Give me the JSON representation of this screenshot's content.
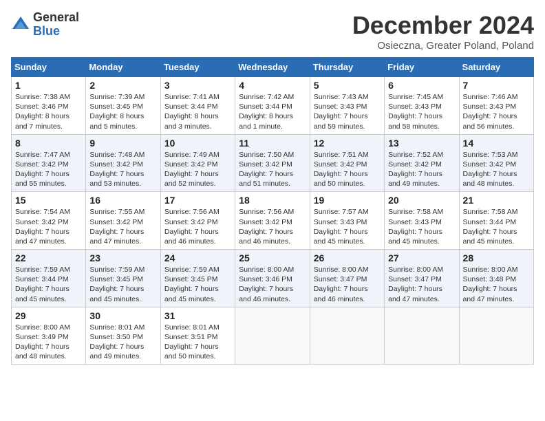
{
  "logo": {
    "general": "General",
    "blue": "Blue"
  },
  "title": "December 2024",
  "subtitle": "Osieczna, Greater Poland, Poland",
  "days_header": [
    "Sunday",
    "Monday",
    "Tuesday",
    "Wednesday",
    "Thursday",
    "Friday",
    "Saturday"
  ],
  "weeks": [
    [
      {
        "day": "1",
        "info": "Sunrise: 7:38 AM\nSunset: 3:46 PM\nDaylight: 8 hours\nand 7 minutes."
      },
      {
        "day": "2",
        "info": "Sunrise: 7:39 AM\nSunset: 3:45 PM\nDaylight: 8 hours\nand 5 minutes."
      },
      {
        "day": "3",
        "info": "Sunrise: 7:41 AM\nSunset: 3:44 PM\nDaylight: 8 hours\nand 3 minutes."
      },
      {
        "day": "4",
        "info": "Sunrise: 7:42 AM\nSunset: 3:44 PM\nDaylight: 8 hours\nand 1 minute."
      },
      {
        "day": "5",
        "info": "Sunrise: 7:43 AM\nSunset: 3:43 PM\nDaylight: 7 hours\nand 59 minutes."
      },
      {
        "day": "6",
        "info": "Sunrise: 7:45 AM\nSunset: 3:43 PM\nDaylight: 7 hours\nand 58 minutes."
      },
      {
        "day": "7",
        "info": "Sunrise: 7:46 AM\nSunset: 3:43 PM\nDaylight: 7 hours\nand 56 minutes."
      }
    ],
    [
      {
        "day": "8",
        "info": "Sunrise: 7:47 AM\nSunset: 3:42 PM\nDaylight: 7 hours\nand 55 minutes."
      },
      {
        "day": "9",
        "info": "Sunrise: 7:48 AM\nSunset: 3:42 PM\nDaylight: 7 hours\nand 53 minutes."
      },
      {
        "day": "10",
        "info": "Sunrise: 7:49 AM\nSunset: 3:42 PM\nDaylight: 7 hours\nand 52 minutes."
      },
      {
        "day": "11",
        "info": "Sunrise: 7:50 AM\nSunset: 3:42 PM\nDaylight: 7 hours\nand 51 minutes."
      },
      {
        "day": "12",
        "info": "Sunrise: 7:51 AM\nSunset: 3:42 PM\nDaylight: 7 hours\nand 50 minutes."
      },
      {
        "day": "13",
        "info": "Sunrise: 7:52 AM\nSunset: 3:42 PM\nDaylight: 7 hours\nand 49 minutes."
      },
      {
        "day": "14",
        "info": "Sunrise: 7:53 AM\nSunset: 3:42 PM\nDaylight: 7 hours\nand 48 minutes."
      }
    ],
    [
      {
        "day": "15",
        "info": "Sunrise: 7:54 AM\nSunset: 3:42 PM\nDaylight: 7 hours\nand 47 minutes."
      },
      {
        "day": "16",
        "info": "Sunrise: 7:55 AM\nSunset: 3:42 PM\nDaylight: 7 hours\nand 47 minutes."
      },
      {
        "day": "17",
        "info": "Sunrise: 7:56 AM\nSunset: 3:42 PM\nDaylight: 7 hours\nand 46 minutes."
      },
      {
        "day": "18",
        "info": "Sunrise: 7:56 AM\nSunset: 3:42 PM\nDaylight: 7 hours\nand 46 minutes."
      },
      {
        "day": "19",
        "info": "Sunrise: 7:57 AM\nSunset: 3:43 PM\nDaylight: 7 hours\nand 45 minutes."
      },
      {
        "day": "20",
        "info": "Sunrise: 7:58 AM\nSunset: 3:43 PM\nDaylight: 7 hours\nand 45 minutes."
      },
      {
        "day": "21",
        "info": "Sunrise: 7:58 AM\nSunset: 3:44 PM\nDaylight: 7 hours\nand 45 minutes."
      }
    ],
    [
      {
        "day": "22",
        "info": "Sunrise: 7:59 AM\nSunset: 3:44 PM\nDaylight: 7 hours\nand 45 minutes."
      },
      {
        "day": "23",
        "info": "Sunrise: 7:59 AM\nSunset: 3:45 PM\nDaylight: 7 hours\nand 45 minutes."
      },
      {
        "day": "24",
        "info": "Sunrise: 7:59 AM\nSunset: 3:45 PM\nDaylight: 7 hours\nand 45 minutes."
      },
      {
        "day": "25",
        "info": "Sunrise: 8:00 AM\nSunset: 3:46 PM\nDaylight: 7 hours\nand 46 minutes."
      },
      {
        "day": "26",
        "info": "Sunrise: 8:00 AM\nSunset: 3:47 PM\nDaylight: 7 hours\nand 46 minutes."
      },
      {
        "day": "27",
        "info": "Sunrise: 8:00 AM\nSunset: 3:47 PM\nDaylight: 7 hours\nand 47 minutes."
      },
      {
        "day": "28",
        "info": "Sunrise: 8:00 AM\nSunset: 3:48 PM\nDaylight: 7 hours\nand 47 minutes."
      }
    ],
    [
      {
        "day": "29",
        "info": "Sunrise: 8:00 AM\nSunset: 3:49 PM\nDaylight: 7 hours\nand 48 minutes."
      },
      {
        "day": "30",
        "info": "Sunrise: 8:01 AM\nSunset: 3:50 PM\nDaylight: 7 hours\nand 49 minutes."
      },
      {
        "day": "31",
        "info": "Sunrise: 8:01 AM\nSunset: 3:51 PM\nDaylight: 7 hours\nand 50 minutes."
      },
      {
        "day": "",
        "info": ""
      },
      {
        "day": "",
        "info": ""
      },
      {
        "day": "",
        "info": ""
      },
      {
        "day": "",
        "info": ""
      }
    ]
  ]
}
